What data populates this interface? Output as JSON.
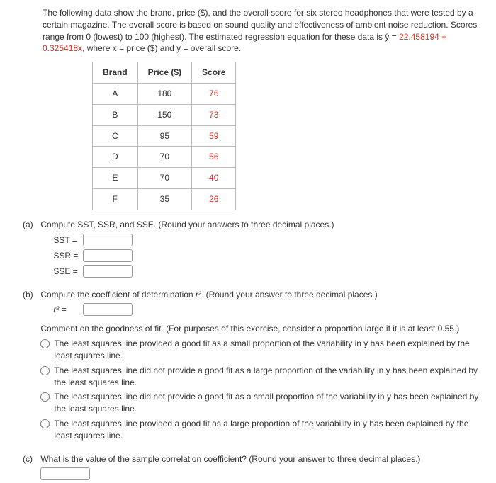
{
  "intro": {
    "line1": "The following data show the brand, price ($), and the overall score for six stereo headphones that were tested by a certain magazine. The overall score is based on sound quality and effectiveness of ambient noise reduction. Scores range from 0 (lowest) to 100 (highest). The estimated regression equation for these data is ",
    "eq_prefix": "ŷ = ",
    "eq_value": "22.458194 + 0.325418x",
    "line1_tail": ", where x = price ($) and y = overall score."
  },
  "table": {
    "headers": [
      "Brand",
      "Price ($)",
      "Score"
    ],
    "rows": [
      {
        "brand": "A",
        "price": "180",
        "score": "76"
      },
      {
        "brand": "B",
        "price": "150",
        "score": "73"
      },
      {
        "brand": "C",
        "price": "95",
        "score": "59"
      },
      {
        "brand": "D",
        "price": "70",
        "score": "56"
      },
      {
        "brand": "E",
        "price": "70",
        "score": "40"
      },
      {
        "brand": "F",
        "price": "35",
        "score": "26"
      }
    ]
  },
  "parts": {
    "a": {
      "label": "(a)",
      "prompt": "Compute SST, SSR, and SSE. (Round your answers to three decimal places.)",
      "items": [
        {
          "label": "SST ="
        },
        {
          "label": "SSR ="
        },
        {
          "label": "SSE ="
        }
      ]
    },
    "b": {
      "label": "(b)",
      "prompt_pre": "Compute the coefficient of determination ",
      "prompt_sym": "r²",
      "prompt_post": ". (Round your answer to three decimal places.)",
      "r2_label": "r² =",
      "comment_prompt": "Comment on the goodness of fit. (For purposes of this exercise, consider a proportion large if it is at least 0.55.)",
      "choices": [
        "The least squares line provided a good fit as a small proportion of the variability in y has been explained by the least squares line.",
        "The least squares line did not provide a good fit as a large proportion of the variability in y has been explained by the least squares line.",
        "The least squares line did not provide a good fit as a small proportion of the variability in y has been explained by the least squares line.",
        "The least squares line provided a good fit as a large proportion of the variability in y has been explained by the least squares line."
      ]
    },
    "c": {
      "label": "(c)",
      "prompt": "What is the value of the sample correlation coefficient? (Round your answer to three decimal places.)"
    }
  }
}
